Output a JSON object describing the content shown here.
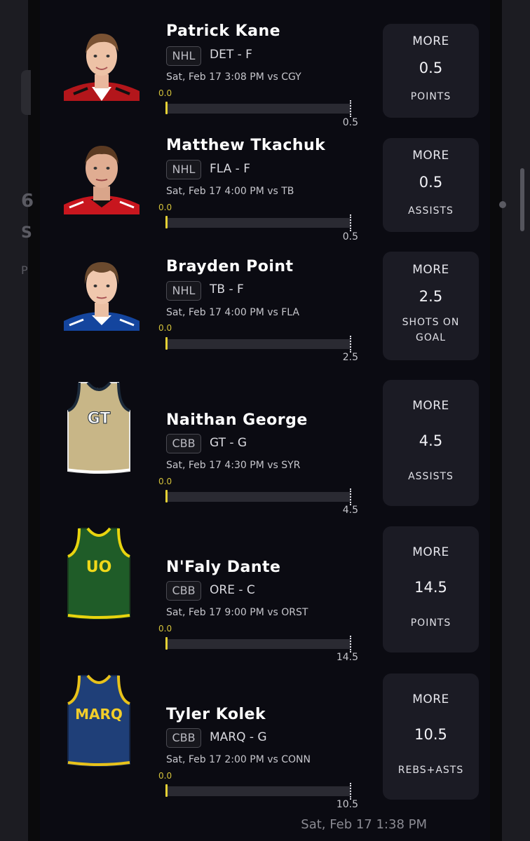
{
  "background_fragments": [
    "6",
    "S",
    "P"
  ],
  "picks": [
    {
      "name": "Patrick Kane",
      "league": "NHL",
      "team_pos": "DET - F",
      "game": "Sat, Feb 17 3:08 PM  vs CGY",
      "zero": "0.0",
      "line": "0.5",
      "more_label": "MORE",
      "more_value": "0.5",
      "stat": [
        "POINTS"
      ],
      "avatar": "headshot-icon"
    },
    {
      "name": "Matthew Tkachuk",
      "league": "NHL",
      "team_pos": "FLA - F",
      "game": "Sat, Feb 17 4:00 PM  vs TB",
      "zero": "0.0",
      "line": "0.5",
      "more_label": "MORE",
      "more_value": "0.5",
      "stat": [
        "ASSISTS"
      ],
      "avatar": "headshot-icon"
    },
    {
      "name": "Brayden Point",
      "league": "NHL",
      "team_pos": "TB - F",
      "game": "Sat, Feb 17 4:00 PM  vs FLA",
      "zero": "0.0",
      "line": "2.5",
      "more_label": "MORE",
      "more_value": "2.5",
      "stat": [
        "SHOTS ON",
        "GOAL"
      ],
      "avatar": "headshot-icon"
    },
    {
      "name": "Naithan George",
      "league": "CBB",
      "team_pos": "GT - G",
      "game": "Sat, Feb 17 4:30 PM  vs SYR",
      "zero": "0.0",
      "line": "4.5",
      "more_label": "MORE",
      "more_value": "4.5",
      "stat": [
        "ASSISTS"
      ],
      "jersey_text": "GT",
      "avatar": "jersey-icon"
    },
    {
      "name": "N'Faly Dante",
      "league": "CBB",
      "team_pos": "ORE - C",
      "game": "Sat, Feb 17 9:00 PM  vs ORST",
      "zero": "0.0",
      "line": "14.5",
      "more_label": "MORE",
      "more_value": "14.5",
      "stat": [
        "POINTS"
      ],
      "jersey_text": "UO",
      "avatar": "jersey-icon"
    },
    {
      "name": "Tyler Kolek",
      "league": "CBB",
      "team_pos": "MARQ - G",
      "game": "Sat, Feb 17 2:00 PM  vs CONN",
      "zero": "0.0",
      "line": "10.5",
      "more_label": "MORE",
      "more_value": "10.5",
      "stat": [
        "REBS+ASTS"
      ],
      "jersey_text": "MARQ",
      "avatar": "jersey-icon"
    }
  ],
  "timestamp": "Sat, Feb 17 1:38 PM",
  "colors": {
    "accent": "#e6d235",
    "sheet": "#0b0b12",
    "button": "#1b1b24"
  }
}
